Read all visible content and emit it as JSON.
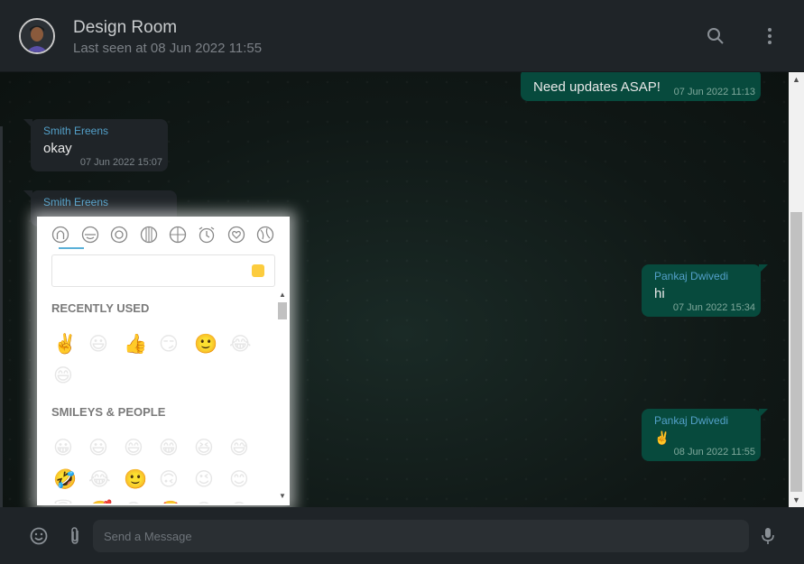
{
  "header": {
    "title": "Design Room",
    "subtitle": "Last seen at 08 Jun 2022 11:55"
  },
  "messages": [
    {
      "direction": "out",
      "text": "Need updates ASAP!",
      "time": "07 Jun 2022 11:13"
    },
    {
      "direction": "in",
      "sender": "Smith Ereens",
      "text": "okay",
      "time": "07 Jun 2022 15:07"
    },
    {
      "direction": "in",
      "sender": "Smith Ereens",
      "text": "",
      "time": ""
    },
    {
      "direction": "out",
      "sender": "Pankaj Dwivedi",
      "text": "hi",
      "time": "07 Jun 2022 15:34"
    },
    {
      "direction": "out",
      "sender": "Pankaj Dwivedi",
      "text": "✌️",
      "time": "08 Jun 2022 11:55"
    }
  ],
  "emoji_picker": {
    "categories": [
      "people-icon",
      "nature-icon",
      "food-icon",
      "activity-icon",
      "travel-icon",
      "objects-icon",
      "symbols-icon",
      "flags-icon"
    ],
    "search_placeholder": "",
    "recently_used_label": "RECENTLY USED",
    "recently_used": [
      "✌️",
      "😃",
      "👍",
      "😏",
      "🙂",
      "😂",
      "😄"
    ],
    "smileys_label": "SMILEYS & PEOPLE",
    "smileys": [
      "😀",
      "😃",
      "😄",
      "😁",
      "😆",
      "😅",
      "🤣",
      "😂",
      "🙂",
      "🙃",
      "😉",
      "😊",
      "😇",
      "🥰",
      "😍",
      "🤩",
      "😘",
      "😗"
    ],
    "skin_tone_color": "#fccc3e"
  },
  "composer": {
    "placeholder": "Send a Message"
  },
  "colors": {
    "incoming_bubble": "#1f2428",
    "outgoing_bubble": "#074a3d",
    "sender_name": "#53a0c9",
    "header_bg": "#1f2428"
  }
}
